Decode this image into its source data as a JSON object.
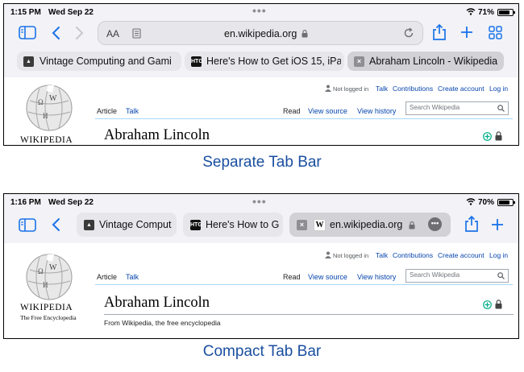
{
  "screens": [
    {
      "status": {
        "time": "1:15 PM",
        "date": "Wed Sep 22",
        "battery": "71%",
        "battery_fill": 0.71
      },
      "toolbar": {
        "text_size": "AA",
        "url": "en.wikipedia.org"
      },
      "tabs": [
        {
          "label": "Vintage Computing and Gami",
          "favicon": "vc-icon"
        },
        {
          "label": "Here's How to Get iOS 15, iPa",
          "favicon": "htg-icon"
        },
        {
          "label": "Abraham Lincoln - Wikipedia",
          "favicon": "close-tab-icon",
          "active": true
        }
      ],
      "page": {
        "user_links": {
          "not_logged_in": "Not logged in",
          "talk": "Talk",
          "contributions": "Contributions",
          "create_account": "Create account",
          "login": "Log in"
        },
        "tabs": {
          "article": "Article",
          "talk": "Talk",
          "read": "Read",
          "view_source": "View source",
          "view_history": "View history"
        },
        "search_placeholder": "Search Wikipedia",
        "wordmark": "Wikipedia",
        "title": "Abraham Lincoln"
      }
    },
    {
      "status": {
        "time": "1:16 PM",
        "date": "Wed Sep 22",
        "battery": "70%",
        "battery_fill": 0.7
      },
      "tabs": [
        {
          "label": "Vintage Comput",
          "favicon": "vc-icon"
        },
        {
          "label": "Here's How to G",
          "favicon": "htg-icon"
        },
        {
          "label": "en.wikipedia.org",
          "favicon": "wikipedia-w-icon",
          "active": true
        }
      ],
      "page": {
        "user_links": {
          "not_logged_in": "Not logged in",
          "talk": "Talk",
          "contributions": "Contributions",
          "create_account": "Create account",
          "login": "Log in"
        },
        "tabs": {
          "article": "Article",
          "talk": "Talk",
          "read": "Read",
          "view_source": "View source",
          "view_history": "View history"
        },
        "search_placeholder": "Search Wikipedia",
        "wordmark": "Wikipedia",
        "tagline": "The Free Encyclopedia",
        "title": "Abraham Lincoln",
        "subtitle": "From Wikipedia, the free encyclopedia"
      }
    }
  ],
  "captions": {
    "first": "Separate Tab Bar",
    "second": "Compact Tab Bar"
  },
  "colors": {
    "accent": "#1a73e8",
    "link": "#0645ad",
    "caption": "#1a4fa0"
  }
}
